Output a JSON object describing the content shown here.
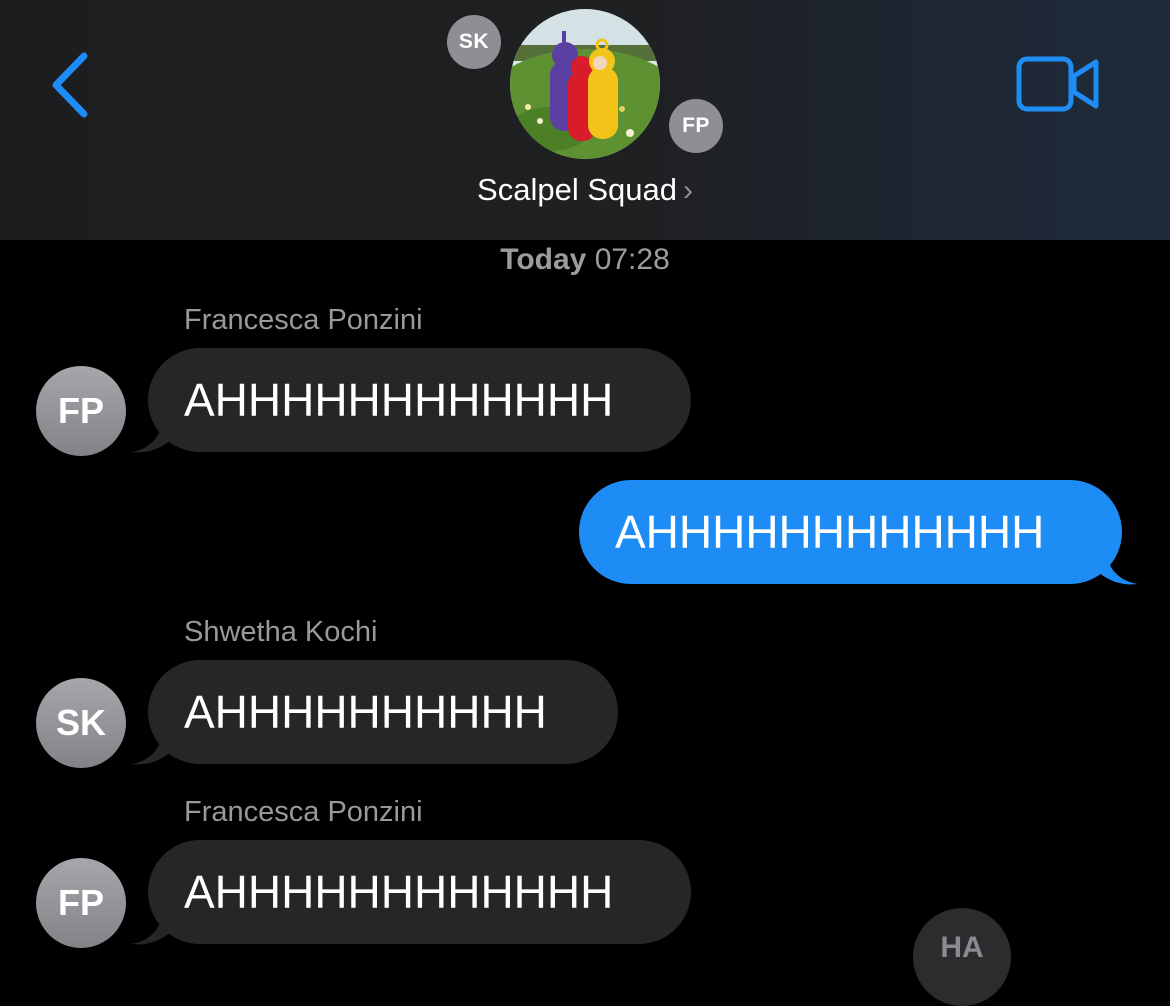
{
  "header": {
    "group_name": "Scalpel Squad",
    "chevron": "›",
    "back_icon": "chevron-left-icon",
    "video_icon": "video-camera-icon",
    "members": [
      {
        "initials": "SK"
      },
      {
        "initials": "FP"
      }
    ]
  },
  "timestamp": {
    "day": "Today",
    "time": "07:28"
  },
  "messages": [
    {
      "sender": "Francesca Ponzini",
      "initials": "FP",
      "text": "AHHHHHHHHHHHH",
      "direction": "incoming"
    },
    {
      "sender": "",
      "initials": "",
      "text": "AHHHHHHHHHHHH",
      "direction": "outgoing"
    },
    {
      "sender": "Shwetha Kochi",
      "initials": "SK",
      "text": "AHHHHHHHHHH",
      "direction": "incoming"
    },
    {
      "sender": "Francesca Ponzini",
      "initials": "FP",
      "text": "AHHHHHHHHHHHH",
      "direction": "incoming"
    }
  ],
  "tapback": {
    "label": "HA"
  },
  "colors": {
    "accent": "#1e8cf5",
    "incoming_bubble": "#262628",
    "background": "#000000",
    "header_bg": "#1f2022"
  }
}
